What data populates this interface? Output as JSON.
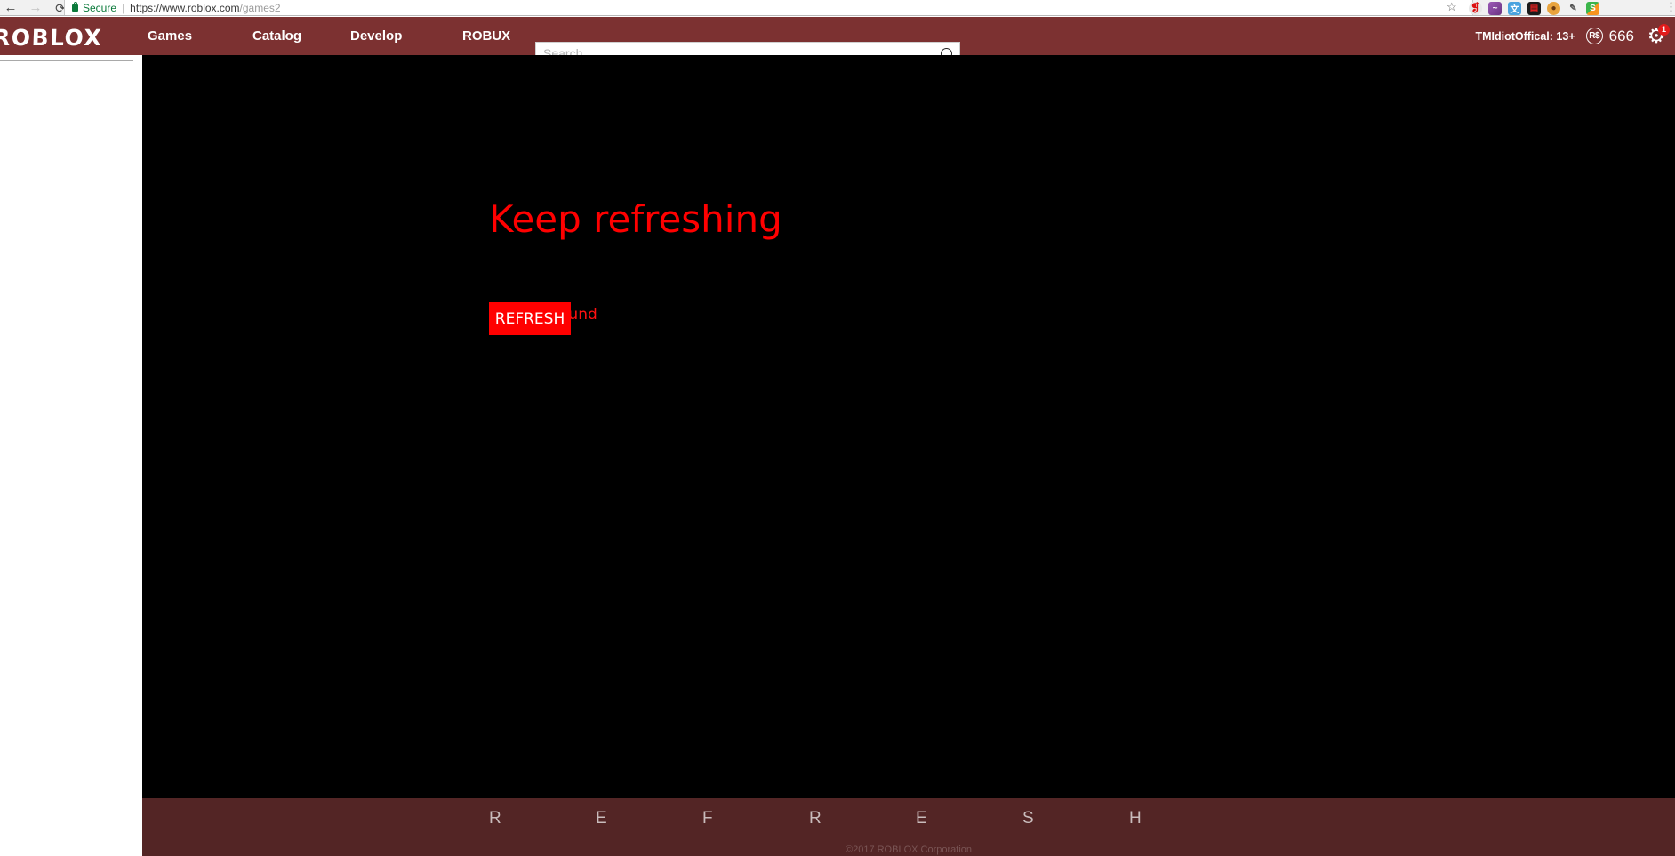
{
  "browser": {
    "back_icon": "back-arrow-icon",
    "forward_icon": "forward-arrow-icon",
    "reload_icon": "reload-icon",
    "reload_glyph": "⟳",
    "back_glyph": "←",
    "forward_glyph": "→",
    "security_label": "Secure",
    "url_separator": "|",
    "url_host": "https://www.roblox.com",
    "url_path": "/games2",
    "bookmark_glyph": "☆",
    "menu_glyph": "⋮",
    "extensions": [
      {
        "name": "avira-extension-icon",
        "glyph": "❡"
      },
      {
        "name": "snake-extension-icon",
        "glyph": "~"
      },
      {
        "name": "translate-extension-icon",
        "glyph": "文"
      },
      {
        "name": "recorder-extension-icon",
        "glyph": "▤"
      },
      {
        "name": "cookie-extension-icon",
        "glyph": "●"
      },
      {
        "name": "eyedropper-extension-icon",
        "glyph": "✎"
      },
      {
        "name": "s-extension-icon",
        "glyph": "S"
      }
    ]
  },
  "header": {
    "logo_text": "ROBLOX",
    "nav": [
      {
        "label": "Games"
      },
      {
        "label": "Catalog"
      },
      {
        "label": "Develop"
      },
      {
        "label": "ROBUX"
      }
    ],
    "search": {
      "placeholder": "Search",
      "value": "",
      "icon": "search-icon"
    },
    "username": "TMIdiotOffical: 13+",
    "robux_symbol": "R$",
    "robux_count": "666",
    "gear_glyph": "⚙",
    "gear_badge": "1",
    "bg_color": "#7c3131"
  },
  "main": {
    "heading": "Keep refreshing",
    "subtext": "almost found",
    "refresh_button": "REFRESH",
    "bg_color": "#000000",
    "accent_color": "#ff0000"
  },
  "footer": {
    "letters": [
      "R",
      "E",
      "F",
      "R",
      "E",
      "S",
      "H"
    ],
    "copyright": "©2017 ROBLOX Corporation",
    "bg_color": "#532525"
  }
}
